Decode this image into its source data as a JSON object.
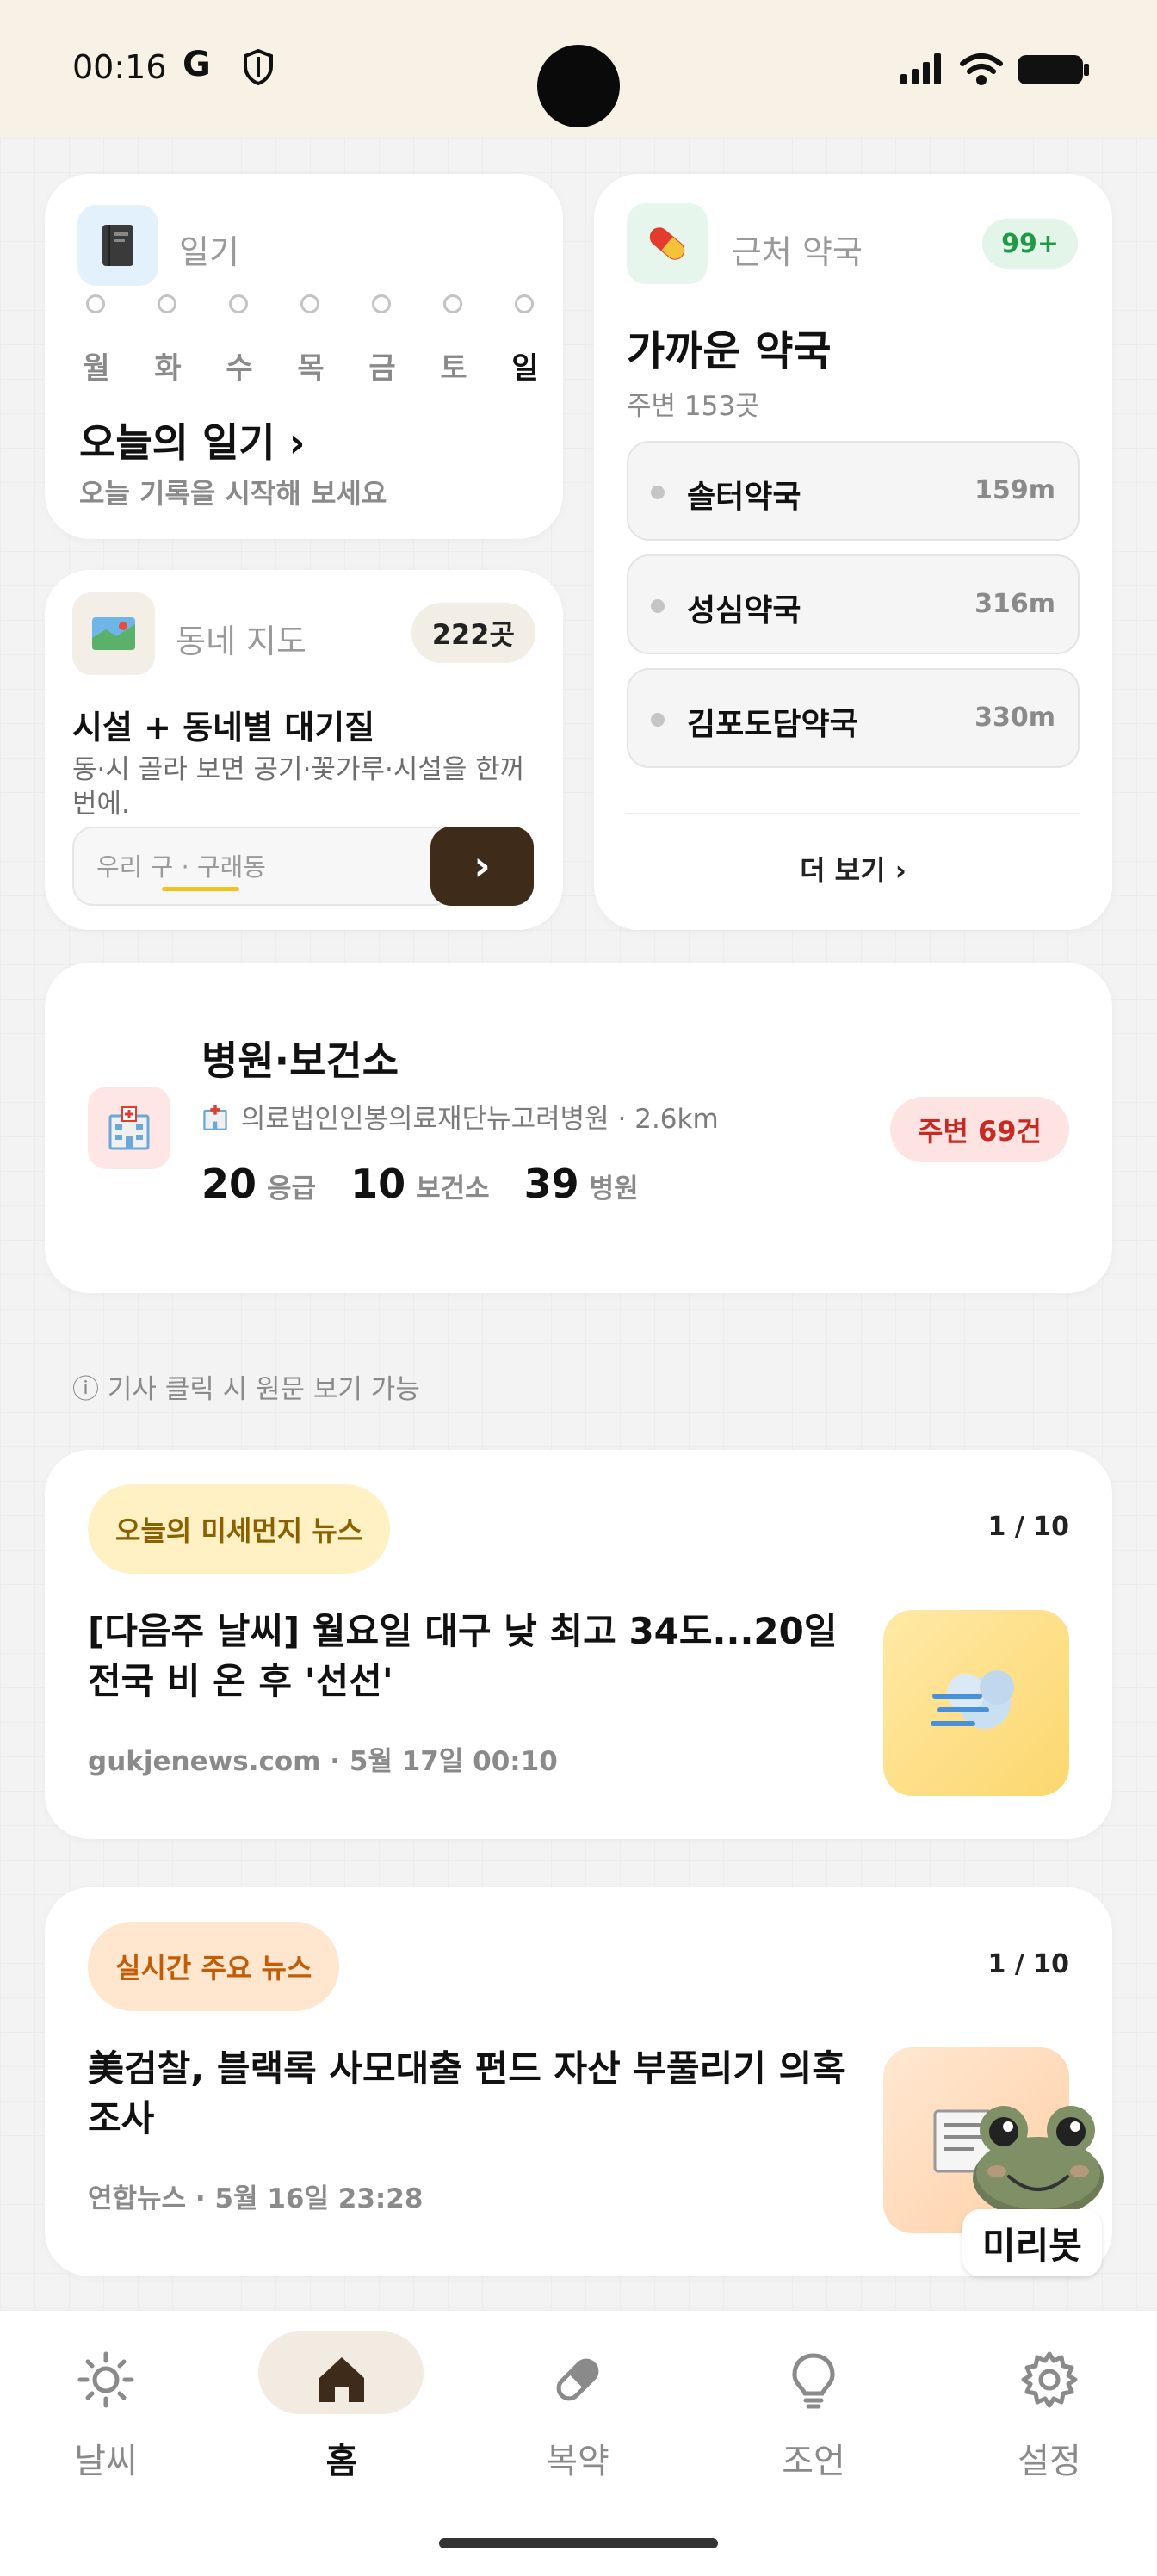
{
  "status_bar": {
    "time": "00:16",
    "g_label": "G"
  },
  "diary": {
    "icon": "notebook-icon",
    "label": "일기",
    "days": [
      "월",
      "화",
      "수",
      "목",
      "금",
      "토",
      "일"
    ],
    "title": "오늘의 일기 ›",
    "subtitle": "오늘 기록을 시작해 보세요"
  },
  "map": {
    "icon": "map-icon",
    "label": "동네 지도",
    "badge": "222곳",
    "title": "시설 + 동네별 대기질",
    "description": "동·시 골라 보면 공기·꽃가루·시설을 한꺼번에.",
    "input_value": "우리 구 · 구래동",
    "go_label": "›"
  },
  "pharmacy": {
    "icon": "pill-icon",
    "label": "근처 약국",
    "badge": "99+",
    "title": "가까운 약국",
    "subtitle": "주변 153곳",
    "items": [
      {
        "name": "솔터약국",
        "distance": "159m"
      },
      {
        "name": "성심약국",
        "distance": "316m"
      },
      {
        "name": "김포도담약국",
        "distance": "330m"
      }
    ],
    "more": "더 보기 ›"
  },
  "hospital": {
    "icon": "hospital-icon",
    "title": "병원·보건소",
    "subtitle": "의료법인인봉의료재단뉴고려병원 · 2.6km",
    "badge": "주변 69건",
    "stats": [
      {
        "value": "20",
        "label": "응급"
      },
      {
        "value": "10",
        "label": "보건소"
      },
      {
        "value": "39",
        "label": "병원"
      }
    ]
  },
  "note": "ⓘ 기사 클릭 시 원문 보기 가능",
  "news_dust": {
    "tag": "오늘의 미세먼지 뉴스",
    "count": "1 / 10",
    "headline": "[다음주 날씨] 월요일 대구 낮 최고 34도...20일 전국 비 온 후 '선선'",
    "source": "gukjenews.com · 5월 17일 00:10",
    "thumb_icon": "wind-icon"
  },
  "news_main": {
    "tag": "실시간 주요 뉴스",
    "count": "1 / 10",
    "headline": "美검찰, 블랙록 사모대출 펀드 자산 부풀리기 의혹 조사",
    "source": "연합뉴스 · 5월 16일 23:28",
    "thumb_icon": "newspaper-icon"
  },
  "mascot": {
    "label": "미리봇"
  },
  "nav": [
    {
      "label": "날씨",
      "icon": "sun-icon",
      "active": false
    },
    {
      "label": "홈",
      "icon": "home-icon",
      "active": true
    },
    {
      "label": "복약",
      "icon": "pill-icon",
      "active": false
    },
    {
      "label": "조언",
      "icon": "lightbulb-icon",
      "active": false
    },
    {
      "label": "설정",
      "icon": "gear-icon",
      "active": false
    }
  ],
  "colors": {
    "header_bg": "#f7f1e6",
    "brown_button": "#3f2b1a",
    "pharmacy_badge_bg": "#e3f5e8",
    "pharmacy_badge_text": "#1f9a47",
    "hospital_badge_bg": "#fde4e2",
    "hospital_badge_text": "#c62a22",
    "dust_tag_bg": "#fff1c4",
    "dust_tag_text": "#8a6100",
    "news_tag_bg": "#ffe6cf",
    "news_tag_text": "#c25c07"
  }
}
